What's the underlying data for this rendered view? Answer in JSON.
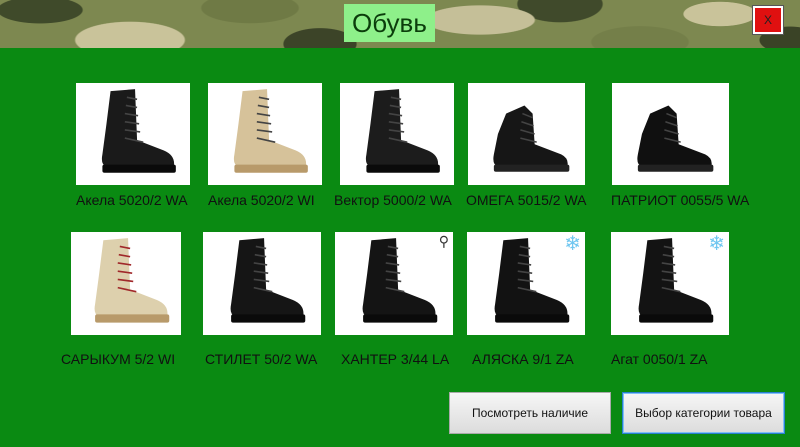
{
  "window": {
    "title": "Обувь",
    "close_label": "X"
  },
  "products": [
    {
      "name": "Акела 5020/2 WA",
      "badge": "",
      "color": "#1a1a1a",
      "style": "boot"
    },
    {
      "name": "Акела 5020/2 WI",
      "badge": "",
      "color": "#d6c29a",
      "style": "boot"
    },
    {
      "name": "Вектор 5000/2 WA",
      "badge": "",
      "color": "#1c1c1c",
      "style": "boot"
    },
    {
      "name": "ОМЕГА 5015/2 WA",
      "badge": "",
      "color": "#161616",
      "style": "low"
    },
    {
      "name": "ПАТРИОТ 0055/5 WA",
      "badge": "",
      "color": "#101010",
      "style": "low"
    },
    {
      "name": "САРЫКУМ 5/2 WI",
      "badge": "",
      "color": "#ddd0ad",
      "style": "boot"
    },
    {
      "name": "СТИЛЕТ 50/2 WA",
      "badge": "",
      "color": "#151515",
      "style": "boot"
    },
    {
      "name": "ХАНТЕР 3/44 LA",
      "badge": "zipper-icon",
      "color": "#141414",
      "style": "boot"
    },
    {
      "name": "АЛЯСКА 9/1 ZA",
      "badge": "snowflake-icon",
      "color": "#121212",
      "style": "boot"
    },
    {
      "name": "Агат 0050/1 ZA",
      "badge": "snowflake-icon",
      "color": "#131313",
      "style": "boot"
    }
  ],
  "buttons": {
    "check_stock": "Посмотреть наличие",
    "choose_category": "Выбор категории товара"
  },
  "colors": {
    "background": "#0a8a12",
    "title_bg": "#8ef08a",
    "close_bg": "#e01010",
    "winter_badge": "#6ec6f0"
  }
}
